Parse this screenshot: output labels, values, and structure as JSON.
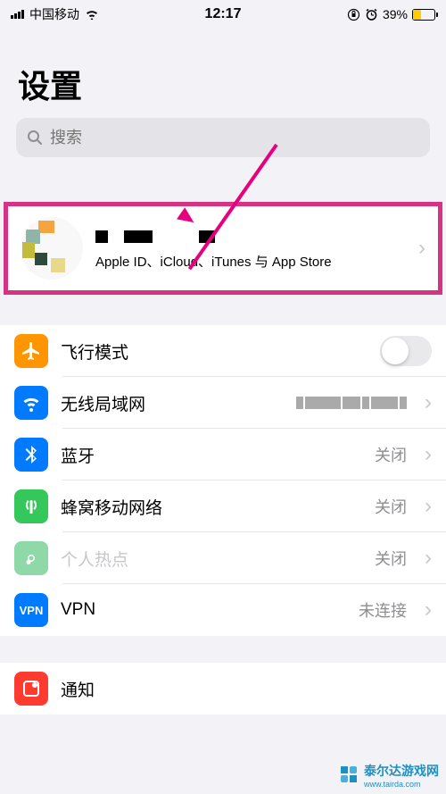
{
  "statusBar": {
    "carrier": "中国移动",
    "time": "12:17",
    "batteryPercent": "39%"
  },
  "title": "设置",
  "search": {
    "placeholder": "搜索"
  },
  "account": {
    "subtitle": "Apple ID、iCloud、iTunes 与 App Store"
  },
  "rows": {
    "airplane": {
      "label": "飞行模式"
    },
    "wifi": {
      "label": "无线局域网"
    },
    "bluetooth": {
      "label": "蓝牙",
      "value": "关闭"
    },
    "cellular": {
      "label": "蜂窝移动网络",
      "value": "关闭"
    },
    "hotspot": {
      "label": "个人热点",
      "value": "关闭"
    },
    "vpn": {
      "label": "VPN",
      "value": "未连接"
    },
    "notifications": {
      "label": "通知"
    }
  },
  "watermark": "泰尔达游戏网",
  "watermarkUrl": "www.tairda.com"
}
